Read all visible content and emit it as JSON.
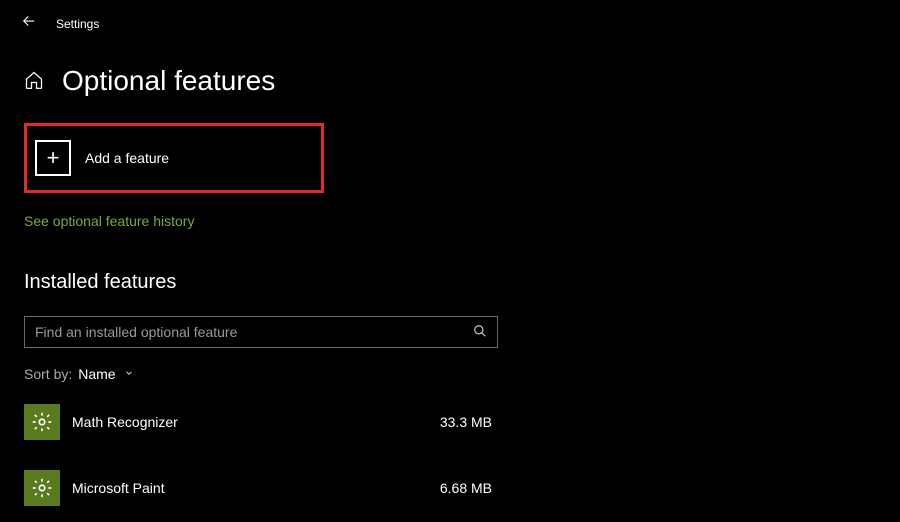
{
  "titlebar": {
    "label": "Settings"
  },
  "header": {
    "title": "Optional features"
  },
  "add_feature": {
    "label": "Add a feature"
  },
  "history_link": "See optional feature history",
  "installed": {
    "heading": "Installed features",
    "search_placeholder": "Find an installed optional feature",
    "sort_label": "Sort by:",
    "sort_value": "Name",
    "items": [
      {
        "name": "Math Recognizer",
        "size": "33.3 MB"
      },
      {
        "name": "Microsoft Paint",
        "size": "6.68 MB"
      }
    ]
  }
}
